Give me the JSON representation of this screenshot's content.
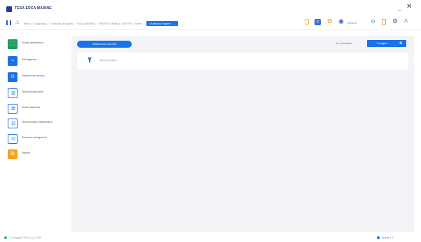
{
  "window": {
    "title": "TESA EDCA MARINE",
    "minimize_glyph": "_",
    "close_glyph": "✕"
  },
  "navbar": {
    "breadcrumbs": [
      "Menu",
      "Diagnosis",
      "Outboard Engines",
      "TESA MARINE",
      "SPORTS WHALE 360 EFI",
      "Menu"
    ],
    "active_crumb": "Outboard Engine",
    "active_crumb_chevron": "⌄",
    "user_label": "Diva.en",
    "badge_glyph": "⊡"
  },
  "sidebar": {
    "items": [
      {
        "label": "Vehicle identification",
        "icon": "vehicle-id-icon",
        "glyph": "⬚",
        "style": "green"
      },
      {
        "label": "Self-diagnosis",
        "icon": "self-diagnosis-icon",
        "glyph": "⌁",
        "style": "blue"
      },
      {
        "label": "Maintenance services",
        "icon": "maintenance-icon",
        "glyph": "⊙",
        "style": "blue-outline",
        "active": true
      },
      {
        "label": "Technical data sheet",
        "icon": "technical-sheet-icon",
        "glyph": "⊞",
        "style": "blue-outline"
      },
      {
        "label": "Guided diagnosis",
        "icon": "guided-diagnosis-icon",
        "glyph": "⌘",
        "style": "blue-outline"
      },
      {
        "label": "Technical data / Maintenance",
        "icon": "data-maintenance-icon",
        "glyph": "⊟",
        "style": "blue-outline"
      },
      {
        "label": "Electronic management",
        "icon": "electronic-icon",
        "glyph": "⊡",
        "style": "blue-outline"
      },
      {
        "label": "Reports",
        "icon": "reports-icon",
        "glyph": "⊠",
        "style": "orange"
      }
    ]
  },
  "main": {
    "pill_button_label": "Maintenance services",
    "all_connections_label": "All connections",
    "configure_label": "Configure",
    "configure_glyph": "⧉",
    "filter_text": "Select a system"
  },
  "status": {
    "left_text": "© Copyright TEXA S.p.A. 2019",
    "right_text": "Update 1.2"
  },
  "colors": {
    "accent": "#1a73e8",
    "green": "#1f9a63",
    "orange": "#f4a21e",
    "background": "#f3f4f7"
  }
}
